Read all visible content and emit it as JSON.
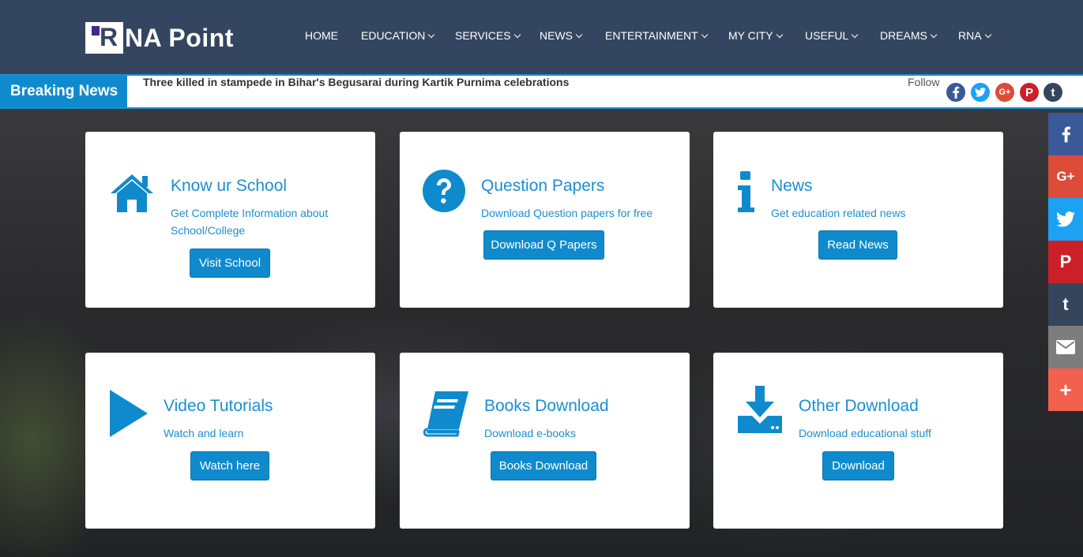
{
  "header": {
    "logo_letter": "R",
    "logo_text": "NA Point",
    "nav": [
      {
        "label": "HOME"
      },
      {
        "label": "EDUCATION"
      },
      {
        "label": "SERVICES"
      },
      {
        "label": "NEWS"
      },
      {
        "label": "ENTERTAINMENT"
      },
      {
        "label": "MY CITY"
      },
      {
        "label": "USEFUL"
      },
      {
        "label": "DREAMS"
      },
      {
        "label": "RNA"
      }
    ]
  },
  "breaking": {
    "label": "Breaking News",
    "headline": "Three killed in stampede in Bihar's Begusarai during Kartik Purnima celebrations",
    "follow_label": "Follow",
    "follow_icons": [
      {
        "glyph": "f",
        "color": "#3b5998"
      },
      {
        "glyph": "t",
        "color": "#1da1f2"
      },
      {
        "glyph": "G+",
        "color": "#dd4b39"
      },
      {
        "glyph": "P",
        "color": "#cb2027"
      },
      {
        "glyph": "t",
        "color": "#35465c"
      }
    ]
  },
  "cards": [
    {
      "title": "Know ur School",
      "desc": "Get Complete Information about School/College",
      "button": "Visit School"
    },
    {
      "title": "Question Papers",
      "desc": "Download Question papers for free",
      "button": "Download Q Papers"
    },
    {
      "title": "News",
      "desc": "Get education related news",
      "button": "Read News"
    },
    {
      "title": "Video Tutorials",
      "desc": "Watch and learn",
      "button": "Watch here"
    },
    {
      "title": "Books Download",
      "desc": "Download e-books",
      "button": "Books Download"
    },
    {
      "title": "Other Download",
      "desc": "Download educational stuff",
      "button": "Download"
    }
  ],
  "share_bar": [
    {
      "glyph": "f",
      "color": "#3b5998"
    },
    {
      "glyph": "G+",
      "color": "#dd4b39"
    },
    {
      "glyph": "twitter",
      "color": "#1da1f2"
    },
    {
      "glyph": "P",
      "color": "#cb2027"
    },
    {
      "glyph": "t",
      "color": "#35465c"
    },
    {
      "glyph": "email",
      "color": "#7d7d7d"
    },
    {
      "glyph": "+",
      "color": "#f2604e"
    }
  ],
  "colors": {
    "accent": "#0f8bcd",
    "navbar": "#34465f"
  }
}
